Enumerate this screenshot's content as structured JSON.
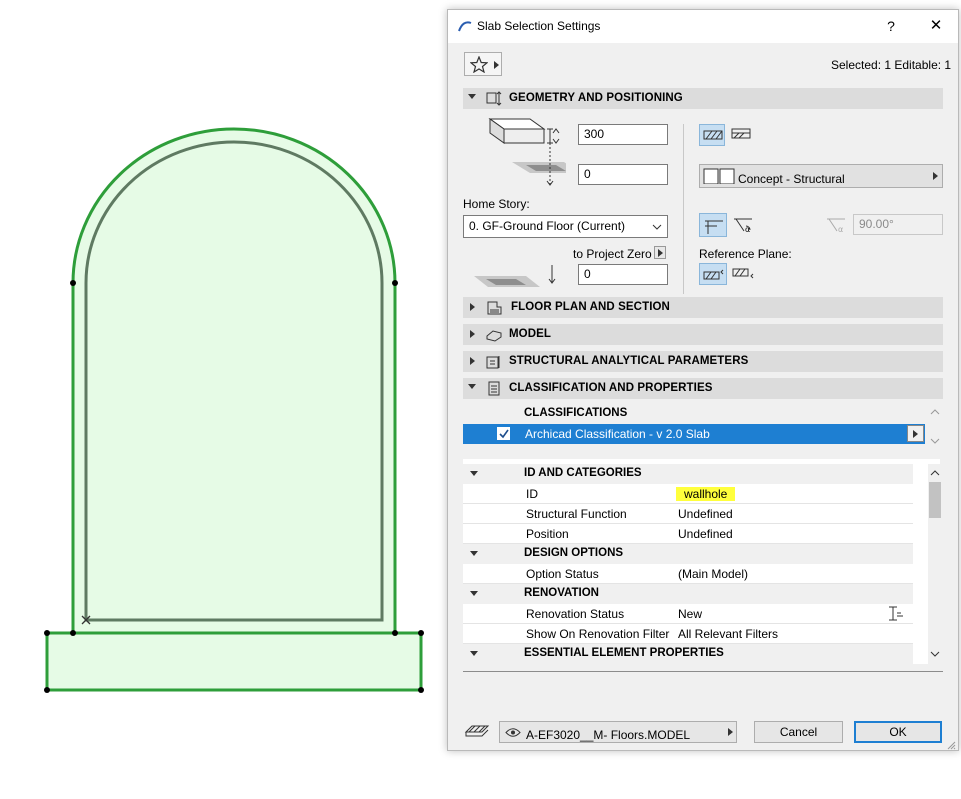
{
  "dialog": {
    "title": "Slab Selection Settings",
    "help_label": "?",
    "close_label": "✕",
    "selected_status": "Selected: 1 Editable: 1"
  },
  "geometry": {
    "header": "GEOMETRY AND POSITIONING",
    "thickness": "300",
    "offset": "0",
    "home_story_label": "Home Story:",
    "home_story_value": "0. GF-Ground Floor (Current)",
    "to_project_zero_label": "to Project Zero",
    "project_zero_value": "0",
    "building_material": "Concept - Structural",
    "angle_value": "90.00°",
    "reference_plane_label": "Reference Plane:"
  },
  "sections": {
    "floor_plan": "FLOOR PLAN AND SECTION",
    "model": "MODEL",
    "structural": "STRUCTURAL ANALYTICAL PARAMETERS",
    "classification": "CLASSIFICATION AND PROPERTIES"
  },
  "classifications": {
    "header": "CLASSIFICATIONS",
    "item": "Archicad Classification - v 2.0 Slab",
    "checked": true
  },
  "properties": {
    "groups": [
      {
        "name": "ID AND CATEGORIES"
      },
      {
        "name": "DESIGN OPTIONS"
      },
      {
        "name": "RENOVATION"
      },
      {
        "name": "ESSENTIAL ELEMENT PROPERTIES"
      }
    ],
    "rows": [
      {
        "key": "ID",
        "value": "wallhole",
        "highlight": "#ffff3c"
      },
      {
        "key": "Structural Function",
        "value": "Undefined"
      },
      {
        "key": "Position",
        "value": "Undefined"
      },
      {
        "key": "Option Status",
        "value": "(Main Model)"
      },
      {
        "key": "Renovation Status",
        "value": "New"
      },
      {
        "key": "Show On Renovation Filter",
        "value": "All Relevant Filters"
      }
    ]
  },
  "footer": {
    "layer": "A-EF3020__M- Floors.MODEL",
    "cancel_label": "Cancel",
    "ok_label": "OK"
  },
  "colors": {
    "accent_blue": "#1e7fd2",
    "shape_fill": "#e6fbe6",
    "shape_stroke": "#2e9e3a",
    "inner_stroke": "#5f7a62",
    "highlight_yellow": "#ffff3c"
  }
}
